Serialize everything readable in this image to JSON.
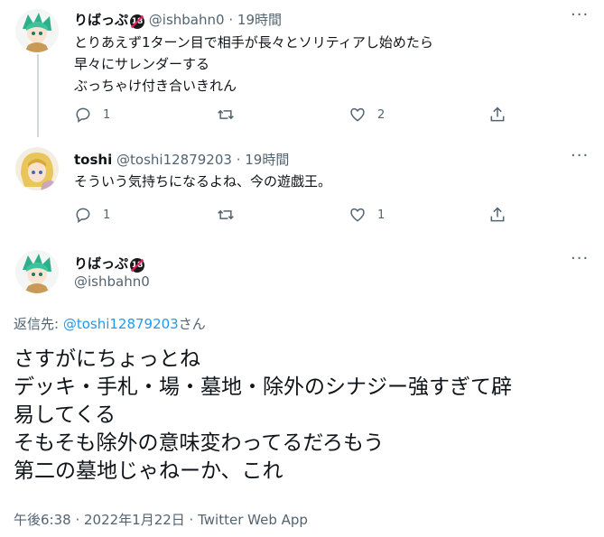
{
  "tweet1": {
    "display_name": "りばっぷ",
    "badge": "18",
    "handle": "@ishbahn0",
    "separator": "·",
    "time": "19時間",
    "lines": [
      "とりあえず1ターン目で相手が長々とソリティアし始めたら",
      "早々にサレンダーする",
      "ぶっちゃけ付き合いきれん"
    ],
    "reply_count": "1",
    "retweet_count": "",
    "like_count": "2"
  },
  "tweet2": {
    "display_name": "toshi",
    "handle": "@toshi12879203",
    "separator": "·",
    "time": "19時間",
    "text": "そういう気持ちになるよね、今の遊戯王。",
    "reply_count": "1",
    "retweet_count": "",
    "like_count": "1"
  },
  "main_tweet": {
    "display_name": "りばっぷ",
    "badge": "18",
    "handle": "@ishbahn0",
    "reply_label": "返信先: ",
    "reply_handle": "@toshi12879203",
    "reply_suffix": "さん",
    "lines": [
      "さすがにちょっとね",
      "デッキ・手札・場・墓地・除外のシナジー強すぎて辟",
      "易してくる",
      "そもそも除外の意味変わってるだろもう",
      "第二の墓地じゃねーか、これ"
    ],
    "meta": "午後6:38 · 2022年1月22日 · Twitter Web App"
  },
  "colors": {
    "text": "#0f1419",
    "muted": "#536471",
    "link": "#1d9bf0",
    "thread_line": "#cfd9de"
  }
}
